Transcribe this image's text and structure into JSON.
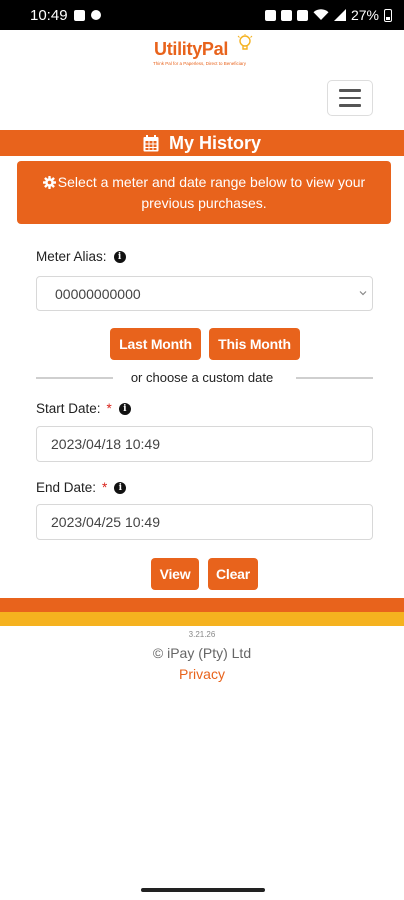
{
  "status_bar": {
    "time": "10:49",
    "battery": "27%"
  },
  "brand": {
    "name": "UtilityPal",
    "tagline": "Think Pal for a Paperless, Direct to Beneficiary"
  },
  "header": {
    "title": "My History"
  },
  "info": {
    "message": "Select a meter and date range below to view your previous purchases."
  },
  "meter": {
    "label": "Meter Alias:",
    "selected": "00000000000"
  },
  "quick_range": {
    "last_month": "Last Month",
    "this_month": "This Month"
  },
  "divider": {
    "text": "or choose a custom date"
  },
  "start_date": {
    "label": "Start Date:",
    "required_mark": "*",
    "value": "2023/04/18 10:49"
  },
  "end_date": {
    "label": "End Date:",
    "required_mark": "*",
    "value": "2023/04/25 10:49"
  },
  "actions": {
    "view": "View",
    "clear": "Clear"
  },
  "footer": {
    "version": "3.21.26",
    "copyright": "© iPay (Pty) Ltd",
    "privacy": "Privacy"
  },
  "colors": {
    "accent": "#e8631c",
    "accent_yellow": "#f5b21f"
  }
}
